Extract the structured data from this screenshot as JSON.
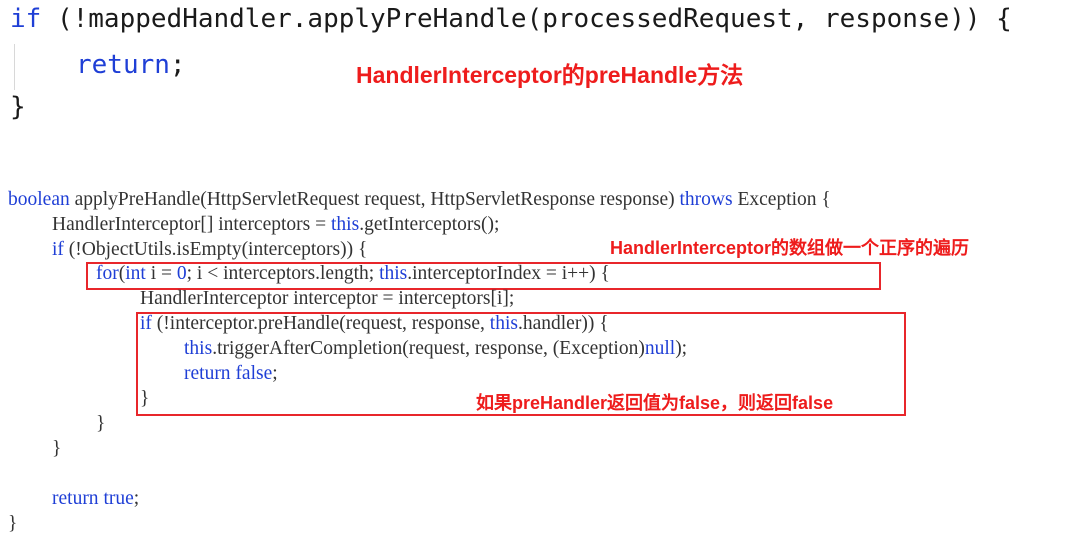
{
  "top_code": {
    "line1": {
      "kw_if": "if",
      "rest": " (!mappedHandler.applyPreHandle(processedRequest, response)) {"
    },
    "line2": {
      "kw_return": "return",
      "rest": ";"
    },
    "line3": {
      "text": "}"
    }
  },
  "bottom_code": {
    "l1": {
      "kw_boolean": "boolean",
      "mid": " applyPreHandle(HttpServletRequest request, HttpServletResponse response) ",
      "kw_throws": "throws",
      "end": " Exception {"
    },
    "l2": {
      "pre": "HandlerInterceptor[] interceptors = ",
      "kw_this": "this",
      "post": ".getInterceptors();"
    },
    "l3": {
      "kw_if": "if",
      "rest": " (!ObjectUtils.isEmpty(interceptors)) {"
    },
    "l4": {
      "kw_for": "for",
      "p1": "(",
      "kw_int": "int",
      "p2": " i = ",
      "n0": "0",
      "p3": "; i < interceptors.length; ",
      "kw_this": "this",
      "p4": ".interceptorIndex = i++) {"
    },
    "l5": {
      "text": "HandlerInterceptor interceptor = interceptors[i];"
    },
    "l6": {
      "kw_if": "if",
      "p1": " (!interceptor.preHandle(request, response, ",
      "kw_this": "this",
      "p2": ".handler)) {"
    },
    "l7": {
      "kw_this": "this",
      "p1": ".triggerAfterCompletion(request, response, (Exception)",
      "kw_null": "null",
      "p2": ");"
    },
    "l8": {
      "kw_return": "return",
      "sp": " ",
      "kw_false": "false",
      "p": ";"
    },
    "l9": {
      "text": "}"
    },
    "l10": {
      "text": "}"
    },
    "l11": {
      "text": "}"
    },
    "l12": {
      "kw_return": "return",
      "sp": " ",
      "kw_true": "true",
      "p": ";"
    },
    "l13": {
      "text": "}"
    }
  },
  "annotations": {
    "note1": "HandlerInterceptor的preHandle方法",
    "note2": "HandlerInterceptor的数组做一个正序的遍历",
    "note3": "如果preHandler返回值为false，则返回false"
  },
  "colors": {
    "keyword": "#1f3fd6",
    "annotation": "#ee1c1c",
    "box": "#e8262b"
  }
}
